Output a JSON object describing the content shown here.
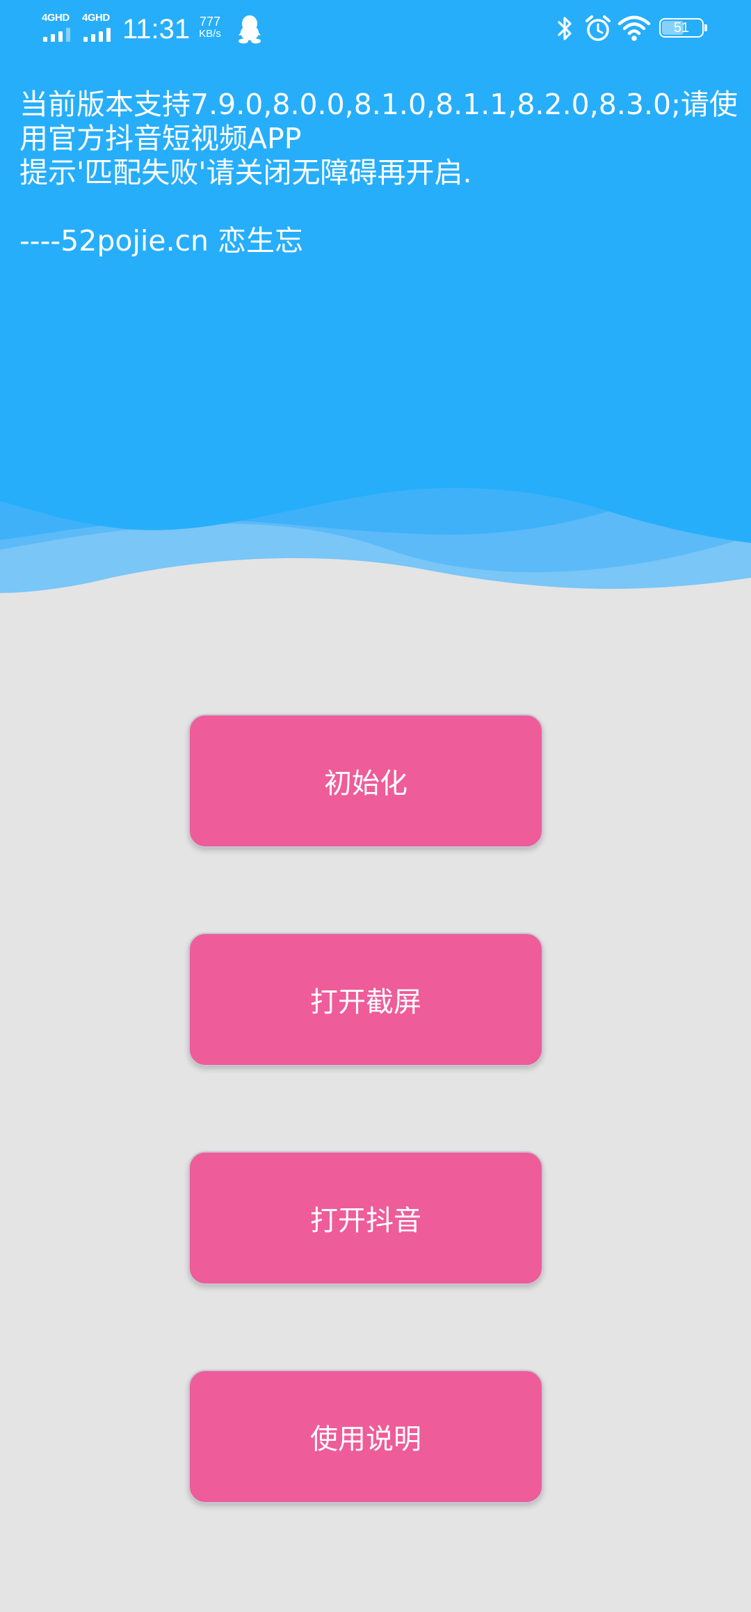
{
  "status_bar": {
    "network_1": "4GHD",
    "network_2": "4GHD",
    "time": "11:31",
    "speed_value": "777",
    "speed_unit": "KB/s",
    "battery_level": "51",
    "icons": [
      "signal-icon",
      "qq-icon",
      "bluetooth-icon",
      "alarm-icon",
      "wifi-icon",
      "battery-icon"
    ]
  },
  "info": {
    "line1": "当前版本支持7.9.0,8.0.0,8.1.0,8.1.1,8.2.0,8.3.0;请使",
    "line2": "用官方抖音短视频APP",
    "line3": "提示'匹配失败'请关闭无障碍再开启.",
    "line4": "----52pojie.cn 恋生忘"
  },
  "buttons": {
    "init": "初始化",
    "open_screenshot": "打开截屏",
    "open_douyin": "打开抖音",
    "instructions": "使用说明"
  },
  "colors": {
    "header_blue": "#26aefb",
    "background": "#e4e4e4",
    "button_pink": "#ee5c9a"
  }
}
